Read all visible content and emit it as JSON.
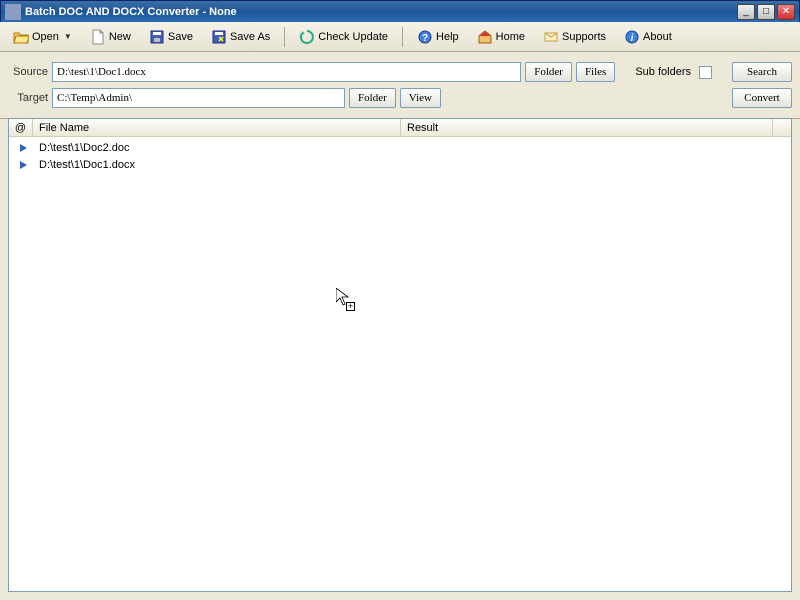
{
  "window": {
    "title": "Batch DOC AND DOCX Converter - None"
  },
  "toolbar": {
    "open": "Open",
    "new": "New",
    "save": "Save",
    "saveAs": "Save As",
    "checkUpdate": "Check Update",
    "help": "Help",
    "home": "Home",
    "supports": "Supports",
    "about": "About"
  },
  "paths": {
    "sourceLabel": "Source",
    "sourceValue": "D:\\test\\1\\Doc1.docx",
    "targetLabel": "Target",
    "targetValue": "C:\\Temp\\Admin\\",
    "folderBtn": "Folder",
    "filesBtn": "Files",
    "viewBtn": "View",
    "subFoldersLabel": "Sub folders",
    "searchBtn": "Search",
    "convertBtn": "Convert"
  },
  "columns": {
    "at": "@",
    "fileName": "File Name",
    "result": "Result"
  },
  "rows": {
    "0": {
      "path": "D:\\test\\1\\Doc2.doc"
    },
    "1": {
      "path": "D:\\test\\1\\Doc1.docx"
    }
  }
}
